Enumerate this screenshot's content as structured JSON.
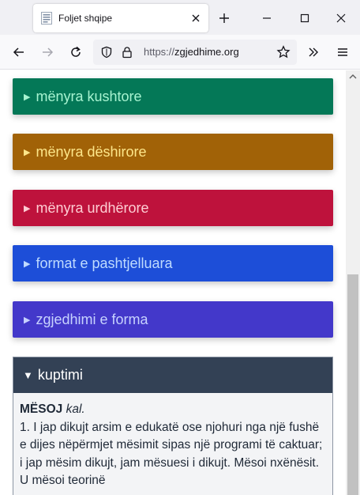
{
  "browser": {
    "tab_title": "Foljet shqipe",
    "url_scheme": "https://",
    "url_host": "zgjedhime.org"
  },
  "sections": [
    {
      "label": "mënyra kushtore",
      "bg": "#047857",
      "fg": "#a7f3d0"
    },
    {
      "label": "mënyra dëshirore",
      "bg": "#a16207",
      "fg": "#fde68a"
    },
    {
      "label": "mënyra urdhërore",
      "bg": "#be123c",
      "fg": "#fecdd3"
    },
    {
      "label": "format e pashtjelluara",
      "bg": "#1d4ed8",
      "fg": "#bfdbfe"
    },
    {
      "label": "zgjedhimi e forma",
      "bg": "#4338ca",
      "fg": "#c7d2fe"
    }
  ],
  "meaning": {
    "header": "kuptimi",
    "headword": "MËSOJ",
    "pos": "kal.",
    "definition": "1. I jap dikujt arsim e edukatë ose njohuri nga një fushë e dijes nëpërmjet mësimit sipas një programi të caktuar; i jap mësim dikujt, jam mësuesi i dikujt. Mësoi nxënësit. U mësoi teorinë"
  }
}
